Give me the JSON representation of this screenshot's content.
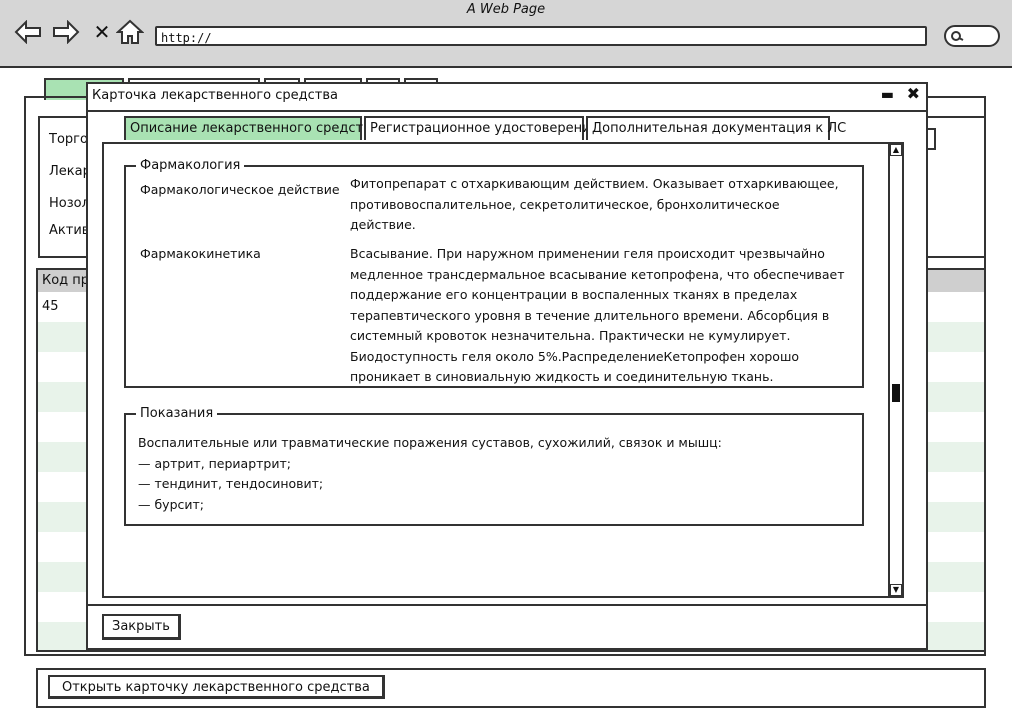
{
  "browser": {
    "title": "A Web Page",
    "url": "http://"
  },
  "background": {
    "filter_labels": [
      "Торго",
      "Лекар",
      "Нозол",
      "Актив"
    ],
    "grid_header": "Код пр",
    "first_row_value": "45",
    "open_card_label": "Открыть карточку лекарственного средства"
  },
  "dialog": {
    "title": "Карточка лекарственного средства",
    "tabs": [
      {
        "label": "Описание лекарственного средства",
        "active": true
      },
      {
        "label": "Регистрационное удостоверение",
        "active": false
      },
      {
        "label": "Дополнительная документация к ЛС",
        "active": false
      }
    ],
    "pharmacology": {
      "legend": "Фармакология",
      "action_label": "Фармакологическое действие",
      "action_text": "Фитопрепарат с отхаркивающим действием. Оказывает отхаркивающее, противовоспалительное, секретолитическое, бронхолитическое действие.",
      "kinetics_label": "Фармакокинетика",
      "kinetics_text": "Всасывание. При наружном применении геля происходит чрезвычайно медленное трансдермальное всасывание кетопрофена, что обеспечивает поддержание его концентрации в воспаленных тканях в пределах терапевтического уровня в течение длительного времени. Абсорбция в системный кровоток незначительна. Практически не кумулирует. Биодоступность геля около 5%.РаспределениеКетопрофен хорошо проникает в синовиальную жидкость и соединительную ткань."
    },
    "indications": {
      "legend": "Показания",
      "lines": [
        "Воспалительные или травматические поражения суставов, сухожилий, связок и мышц:",
        "— артрит, периартрит;",
        "— тендинит, тендосиновит;",
        "— бурсит;"
      ]
    },
    "close_label": "Закрыть"
  }
}
